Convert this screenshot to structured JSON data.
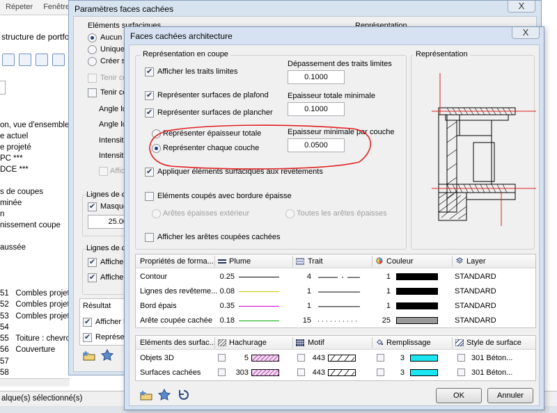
{
  "background_app": {
    "menu": [
      "Répeter",
      "Fenêtre"
    ],
    "palette_title": "structure de portfol",
    "tree_items": [
      "on, vue d'ensemble",
      "e actuel",
      "e projeté",
      "PC ***",
      "DCE ***",
      "",
      "s de coupes",
      "minée",
      "n",
      "nissement coupe",
      "",
      "aussée"
    ],
    "numbered_items": [
      {
        "num": "51",
        "label": "Combles projet"
      },
      {
        "num": "52",
        "label": "Combles projet"
      },
      {
        "num": "53",
        "label": "Combles projet"
      },
      {
        "num": "54",
        "label": ""
      },
      {
        "num": "55",
        "label": "Toiture : chevron"
      },
      {
        "num": "56",
        "label": "Couverture"
      },
      {
        "num": "57",
        "label": ""
      },
      {
        "num": "58",
        "label": ""
      }
    ],
    "status_text": "alque(s) sélectionné(s)"
  },
  "dialog_hidden": {
    "title": "Paramètres faces cachées",
    "close": "X",
    "group1_title": "Eléments surfaciques",
    "group2_title": "Représentation",
    "radio1": "Aucun é",
    "radio2": "Uniquen",
    "radio3": "Créer su",
    "opt_tenir1": "Tenir co",
    "opt_tenir2": "Tenir co",
    "angle1": "Angle lu",
    "angle2": "Angle lu",
    "intens1": "Intensit",
    "intens2": "Intensit",
    "affich_dis": "Affich",
    "lignes1_title": "Lignes de c",
    "masque": "Masque",
    "masque_value": "25.00",
    "lignes2_title": "Lignes de c",
    "afficher1": "Afficher",
    "afficher2": "Afficher",
    "result_title": "Résultat",
    "result_afficher": "Afficher la",
    "result_repres": "Représen"
  },
  "dialog_arch": {
    "title": "Faces cachées architecture",
    "close": "X",
    "coupe_group": "Représentation en coupe",
    "repr_group": "Représentation",
    "cb_traits_limites": "Afficher les traits limites",
    "cb_plafond": "Représenter surfaces de plafond",
    "cb_plancher": "Représenter surfaces de plancher",
    "rb_epaisseur_totale": "Représenter épaisseur totale",
    "rb_chaque_couche": "Représenter chaque couche",
    "cb_appliquer": "Appliquer éléments surfaciques aux revêtements",
    "cb_bordure": "Eléments coupés avec bordure épaisse",
    "rb_aretes_ext": "Arêtes épaisses extérieur",
    "rb_toutes_aretes": "Toutes les arêtes épaisses",
    "cb_aretes_cachees": "Afficher les arêtes coupées cachées",
    "depassement_label": "Dépassement des traits limites",
    "depassement_value": "0.1000",
    "epaisseur_totale_label": "Epaisseur totale minimale",
    "epaisseur_totale_value": "0.1000",
    "epaisseur_couche_label": "Epaisseur minimale par couche",
    "epaisseur_couche_value": "0.0500",
    "table1": {
      "headers": [
        "Propriétés de forma...",
        "Plume",
        "Trait",
        "Couleur",
        "Layer"
      ],
      "rows": [
        {
          "name": "Contour",
          "plume": "0.25",
          "plume_color": "#000000",
          "trait": "4",
          "couleur": "1",
          "swatch": "#000000",
          "layer": "STANDARD"
        },
        {
          "name": "Lignes des revêteme...",
          "plume": "0.08",
          "plume_color": "#c8c800",
          "trait": "1",
          "couleur": "1",
          "swatch": "#000000",
          "layer": "STANDARD"
        },
        {
          "name": "Bord épais",
          "plume": "0.35",
          "plume_color": "#d000d0",
          "trait": "1",
          "couleur": "1",
          "swatch": "#000000",
          "layer": "STANDARD"
        },
        {
          "name": "Arête coupée cachée",
          "plume": "0.18",
          "plume_color": "#00b000",
          "trait": "15",
          "couleur": "25",
          "swatch": "#9a9a9a",
          "layer": "STANDARD"
        }
      ]
    },
    "table2": {
      "headers": [
        "Eléments des surfac...",
        "Hachurage",
        "Motif",
        "Remplissage",
        "Style de surface"
      ],
      "rows": [
        {
          "name": "Objets 3D",
          "hachurage": "5",
          "motif": "443",
          "remplissage": "3",
          "fill_color": "#19e6f0",
          "style": "301 Béton..."
        },
        {
          "name": "Surfaces cachées",
          "hachurage": "303",
          "motif": "443",
          "remplissage": "3",
          "fill_color": "#19e6f0",
          "style": "301 Béton..."
        }
      ]
    },
    "ok_label": "OK",
    "cancel_label": "Annuler",
    "accent_annotation_color": "#e02020"
  }
}
